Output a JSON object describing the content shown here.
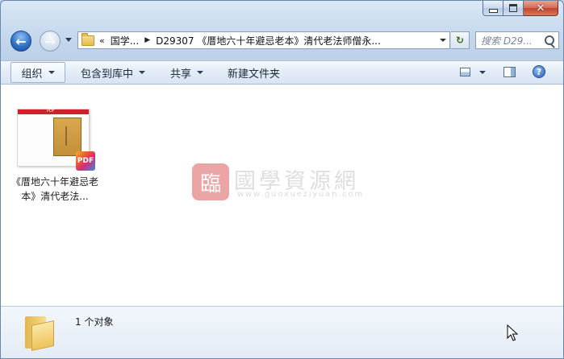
{
  "window": {
    "caption": {
      "minimize": "minimize",
      "maximize": "maximize",
      "close": "✕"
    }
  },
  "nav": {
    "address_chevron": "«",
    "breadcrumbs": [
      "国学...",
      "D29307 《厝地六十年避忌老本》清代老法师僧永..."
    ],
    "search_placeholder": "搜索 D29...",
    "refresh_glyph": "↻"
  },
  "toolbar": {
    "organize": "组织",
    "include_in_library": "包含到库中",
    "share": "共享",
    "new_folder": "新建文件夹",
    "help_glyph": "?"
  },
  "files": [
    {
      "name": "《厝地六十年避忌老本》清代老法...",
      "badge": "PDF",
      "thumb_header": "PDF"
    }
  ],
  "watermark": {
    "seal": "臨",
    "title": "國學資源網",
    "url": "www.guoxueziyuan.com"
  },
  "details": {
    "item_count": "1 个对象"
  },
  "colors": {
    "accent": "#2d6bc4",
    "close_button": "#c2432a",
    "pdf_red": "#d1202b"
  }
}
